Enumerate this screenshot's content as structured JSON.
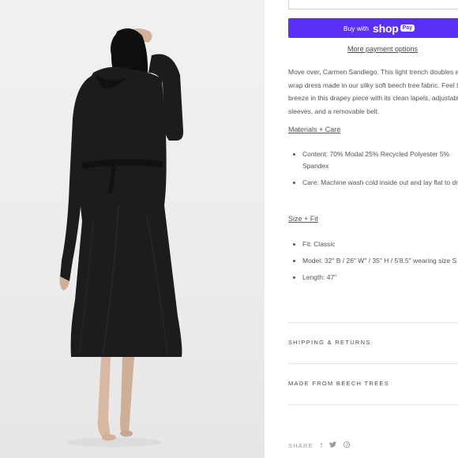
{
  "product": {
    "image_alt": "Model wearing black long-sleeve wrap dress, back view"
  },
  "checkout": {
    "buy_with_label": "Buy with",
    "shop_label": "shop",
    "pay_badge": "Pay",
    "more_payment_options": "More payment options"
  },
  "description": "Move over, Carmen Sandiego. This light trench doubles as a wrap dress made in our silky soft beech tree fabric. Feel the breeze in this drapey piece with its clean lapels, adjustable sleeves, and a removable belt.",
  "materials": {
    "title": "Materials + Care",
    "items": [
      "Content: 70% Modal 25% Recycled Polyester 5% Spandex",
      "Care: Machine wash cold inside out and lay flat to dry"
    ]
  },
  "size_fit": {
    "title": "Size + Fit",
    "items": [
      "Fit: Classic",
      "Model: 32\" B / 26\" W\" / 35\" H / 5'8.5\" wearing size S",
      "Length: 47\""
    ]
  },
  "accordions": [
    {
      "label": "SHIPPING & RETURNS"
    },
    {
      "label": "MADE FROM BEECH TREES"
    }
  ],
  "share": {
    "label": "SHARE",
    "icons": [
      "facebook-icon",
      "twitter-icon",
      "pinterest-icon"
    ]
  },
  "colors": {
    "shop_pay": "#5a31f4",
    "dress": "#1c1c1e",
    "background": "#ececec"
  }
}
